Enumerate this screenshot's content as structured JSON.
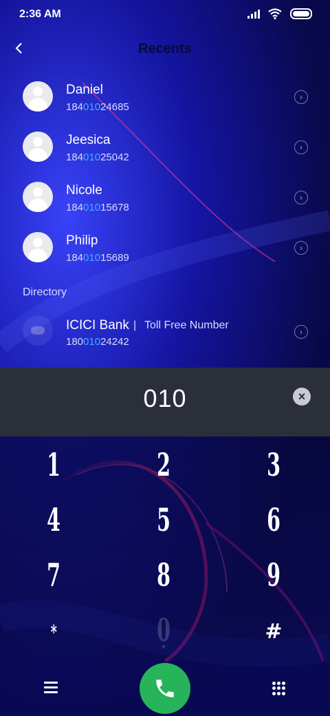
{
  "status_bar": {
    "time": "2:36 AM"
  },
  "header": {
    "title": "Recents"
  },
  "contacts": [
    {
      "name": "Daniel",
      "num_pre": "184",
      "num_hl": "010",
      "num_post": "24685"
    },
    {
      "name": "Jeesica",
      "num_pre": "184",
      "num_hl": "010",
      "num_post": "25042"
    },
    {
      "name": "Nicole",
      "num_pre": "184",
      "num_hl": "010",
      "num_post": "15678"
    },
    {
      "name": "Philip",
      "num_pre": "184",
      "num_hl": "010",
      "num_post": "15689"
    }
  ],
  "directory": {
    "section_label": "Directory",
    "name": "ICICI Bank",
    "separator": "|",
    "tag": "Toll Free Number",
    "num_pre": "180",
    "num_hl": "010",
    "num_post": "24242"
  },
  "dial_input": {
    "value": "010"
  },
  "keypad": {
    "keys": [
      "1",
      "2",
      "3",
      "4",
      "5",
      "6",
      "7",
      "8",
      "9",
      "*",
      "0",
      "#"
    ],
    "zero_sub": "+"
  },
  "colors": {
    "accent_number": "#3fb0ff",
    "call_button": "#27b35a",
    "input_bar": "#2b2f39"
  }
}
